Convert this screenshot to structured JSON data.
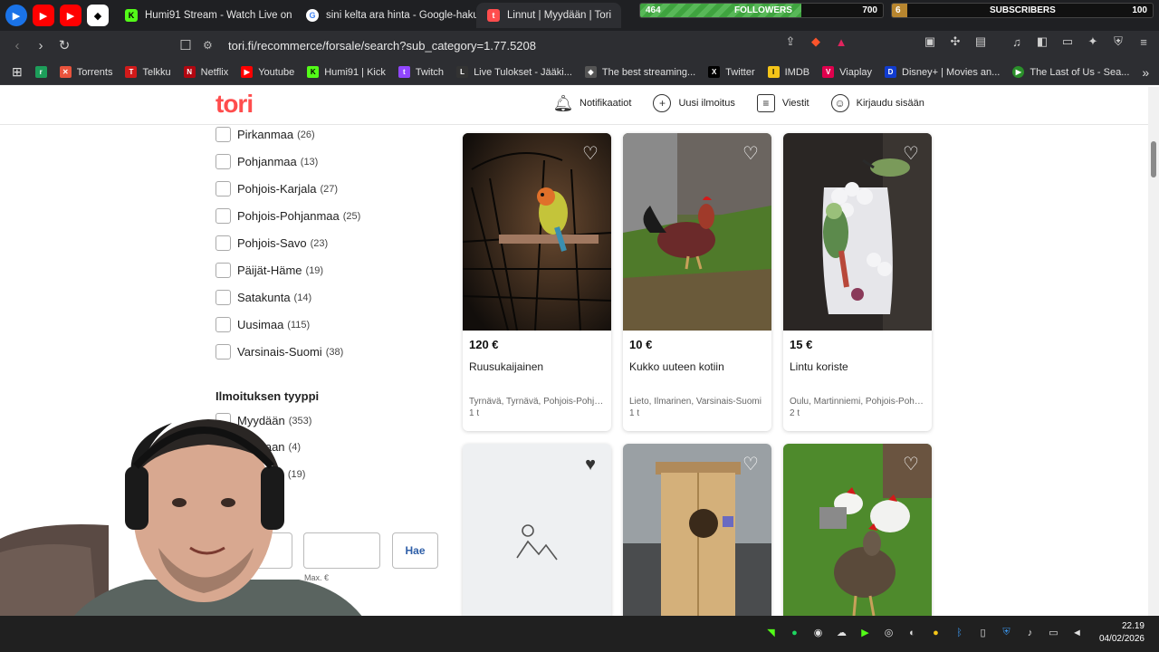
{
  "browser": {
    "tabs": [
      {
        "label": "Humi91 Stream - Watch Live on Kick",
        "color": "#53fc18",
        "glyph": "K"
      },
      {
        "label": "sini kelta ara hinta - Google-haku",
        "color": "#4285f4",
        "glyph": "G"
      },
      {
        "label": "Linnut | Myydään | Tori",
        "color": "#ff4d4d",
        "glyph": "t"
      }
    ],
    "url": "tori.fi/recommerce/forsale/search?sub_category=1.77.5208",
    "bookmarks": [
      {
        "label": "Torrents",
        "color": "#e8533c",
        "glyph": "T"
      },
      {
        "label": "Telkku",
        "color": "#d21a1a",
        "glyph": "T"
      },
      {
        "label": "Netflix",
        "color": "#b20710",
        "glyph": "N"
      },
      {
        "label": "Youtube",
        "color": "#ff0000",
        "glyph": "▶"
      },
      {
        "label": "Humi91 | Kick",
        "color": "#53fc18",
        "glyph": "K"
      },
      {
        "label": "Twitch",
        "color": "#9146ff",
        "glyph": "t"
      },
      {
        "label": "Live Tulokset - Jääki...",
        "color": "#333333",
        "glyph": "L"
      },
      {
        "label": "The best streaming...",
        "color": "#555555",
        "glyph": "◆"
      },
      {
        "label": "Twitter",
        "color": "#000000",
        "glyph": "X"
      },
      {
        "label": "IMDB",
        "color": "#f5c518",
        "glyph": "I"
      },
      {
        "label": "Viaplay",
        "color": "#e0004d",
        "glyph": "V"
      },
      {
        "label": "Disney+ | Movies an...",
        "color": "#113ccf",
        "glyph": "D"
      },
      {
        "label": "The Last of Us - Sea...",
        "color": "#2a8f2a",
        "glyph": "●"
      }
    ]
  },
  "overlay": {
    "followers_current": "464",
    "followers_label": "FOLLOWERS",
    "followers_goal": "700",
    "followers_progress": 0.663,
    "subs_current": "6",
    "subs_label": "SUBSCRIBERS",
    "subs_goal": "100",
    "subs_progress": 0.06
  },
  "site": {
    "logo": "tori",
    "nav": {
      "notifications": "Notifikaatiot",
      "new_listing": "Uusi ilmoitus",
      "messages": "Viestit",
      "login": "Kirjaudu sisään"
    }
  },
  "filters": {
    "regions": [
      {
        "name": "Pirkanmaa",
        "count": "(26)"
      },
      {
        "name": "Pohjanmaa",
        "count": "(13)"
      },
      {
        "name": "Pohjois-Karjala",
        "count": "(27)"
      },
      {
        "name": "Pohjois-Pohjanmaa",
        "count": "(25)"
      },
      {
        "name": "Pohjois-Savo",
        "count": "(23)"
      },
      {
        "name": "Päijät-Häme",
        "count": "(19)"
      },
      {
        "name": "Satakunta",
        "count": "(14)"
      },
      {
        "name": "Uusimaa",
        "count": "(115)"
      },
      {
        "name": "Varsinais-Suomi",
        "count": "(38)"
      }
    ],
    "type_title": "Ilmoituksen tyyppi",
    "types": [
      {
        "name": "Myydään",
        "count": "(353)"
      },
      {
        "name": "etaan",
        "count": "(4)"
      },
      {
        "name": "staan",
        "count": "(19)"
      }
    ],
    "max_label": "Max. €",
    "search_button": "Hae"
  },
  "listings": [
    {
      "price": "120 €",
      "title": "Ruusukaijainen",
      "location": "Tyrnävä, Tyrnävä, Pohjois-Pohjanmaa",
      "age": "1 t"
    },
    {
      "price": "10 €",
      "title": "Kukko uuteen kotiin",
      "location": "Lieto, Ilmarinen, Varsinais-Suomi",
      "age": "1 t"
    },
    {
      "price": "15 €",
      "title": "Lintu koriste",
      "location": "Oulu, Martinniemi, Pohjois-Pohjanmaa",
      "age": "2 t"
    }
  ],
  "taskbar": {
    "time": "22.19",
    "date": "04/02/2026"
  }
}
